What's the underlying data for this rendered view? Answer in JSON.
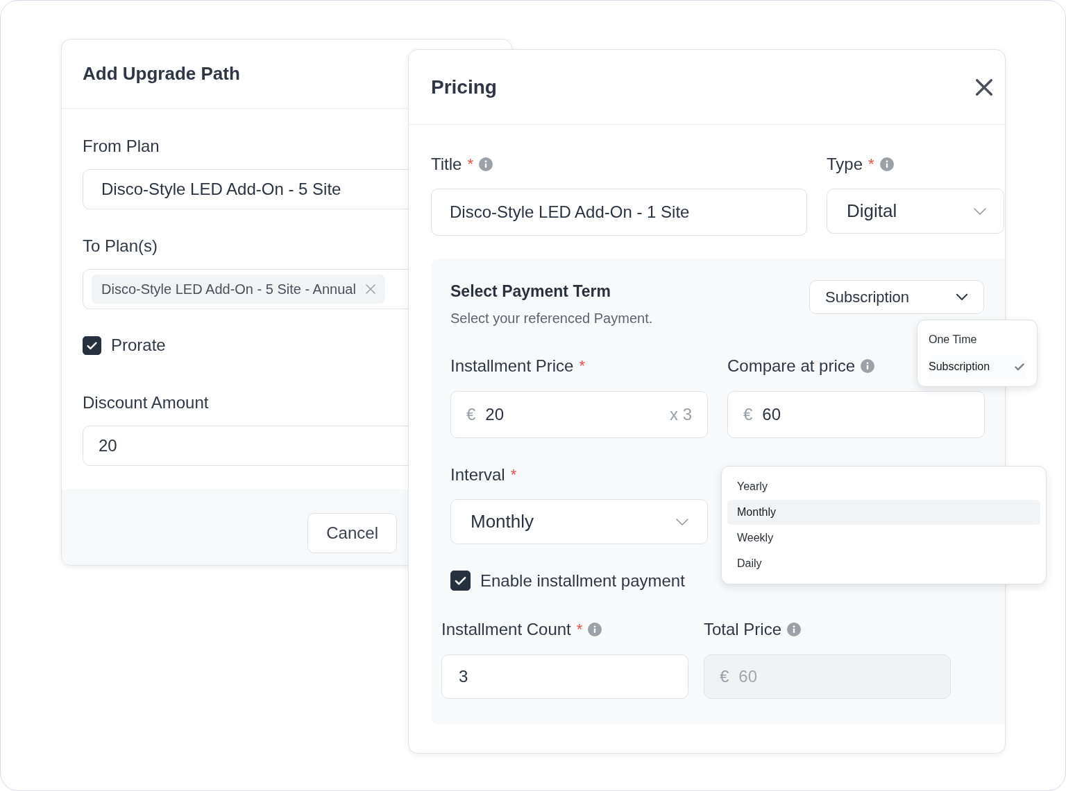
{
  "upgrade_dialog": {
    "title": "Add Upgrade Path",
    "from_plan": {
      "label": "From Plan",
      "value": "Disco-Style LED Add-On - 5 Site"
    },
    "to_plans": {
      "label": "To Plan(s)",
      "tags": [
        {
          "label": "Disco-Style LED Add-On - 5 Site - Annual",
          "removable": true
        }
      ]
    },
    "prorate": {
      "label": "Prorate",
      "checked": true
    },
    "discount": {
      "label": "Discount Amount",
      "value": "20"
    },
    "buttons": [
      "Cancel"
    ]
  },
  "pricing_dialog": {
    "title": "Pricing",
    "title_field": {
      "label": "Title",
      "required_mark": "*",
      "info": true,
      "value": "Disco-Style LED Add-On - 1 Site"
    },
    "type_field": {
      "label": "Type",
      "required_mark": "*",
      "info": true,
      "value": "Digital"
    },
    "payment_term": {
      "heading": "Select Payment Term",
      "subtitle": "Select your referenced Payment.",
      "value": "Subscription",
      "menu": [
        {
          "label": "One Time",
          "selected": false
        },
        {
          "label": "Subscription",
          "selected": true
        }
      ]
    },
    "installment_price": {
      "label": "Installment Price",
      "required_mark": "*",
      "currency": "€",
      "value": "20",
      "suffix": "x 3"
    },
    "compare_price": {
      "label": "Compare at price",
      "info": true,
      "currency": "€",
      "value": "60"
    },
    "interval": {
      "label": "Interval",
      "required_mark": "*",
      "value": "Monthly",
      "menu": [
        {
          "label": "Yearly",
          "selected": false
        },
        {
          "label": "Monthly",
          "selected": true
        },
        {
          "label": "Weekly",
          "selected": false
        },
        {
          "label": "Daily",
          "selected": false
        }
      ]
    },
    "installment_toggle": {
      "label": "Enable installment payment",
      "checked": true
    },
    "installment_count": {
      "label": "Installment Count",
      "required_mark": "*",
      "info": true,
      "value": "3"
    },
    "total_price": {
      "label": "Total Price",
      "info": true,
      "currency": "€",
      "value": "60",
      "disabled": true
    }
  }
}
